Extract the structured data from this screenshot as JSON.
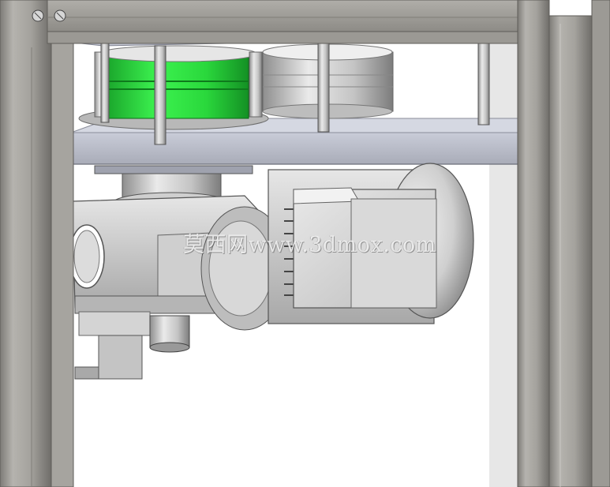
{
  "image": {
    "subject": "gear-motor-assembly-under-platform",
    "watermark_text": "莫西网www.3dmox.com",
    "colors": {
      "frame": "#9c9a95",
      "frame_dark": "#6f6d69",
      "platform": "#b9bcc8",
      "green_part": "#27d63a",
      "metal": "#c8c8c8",
      "background": "#ffffff"
    }
  }
}
